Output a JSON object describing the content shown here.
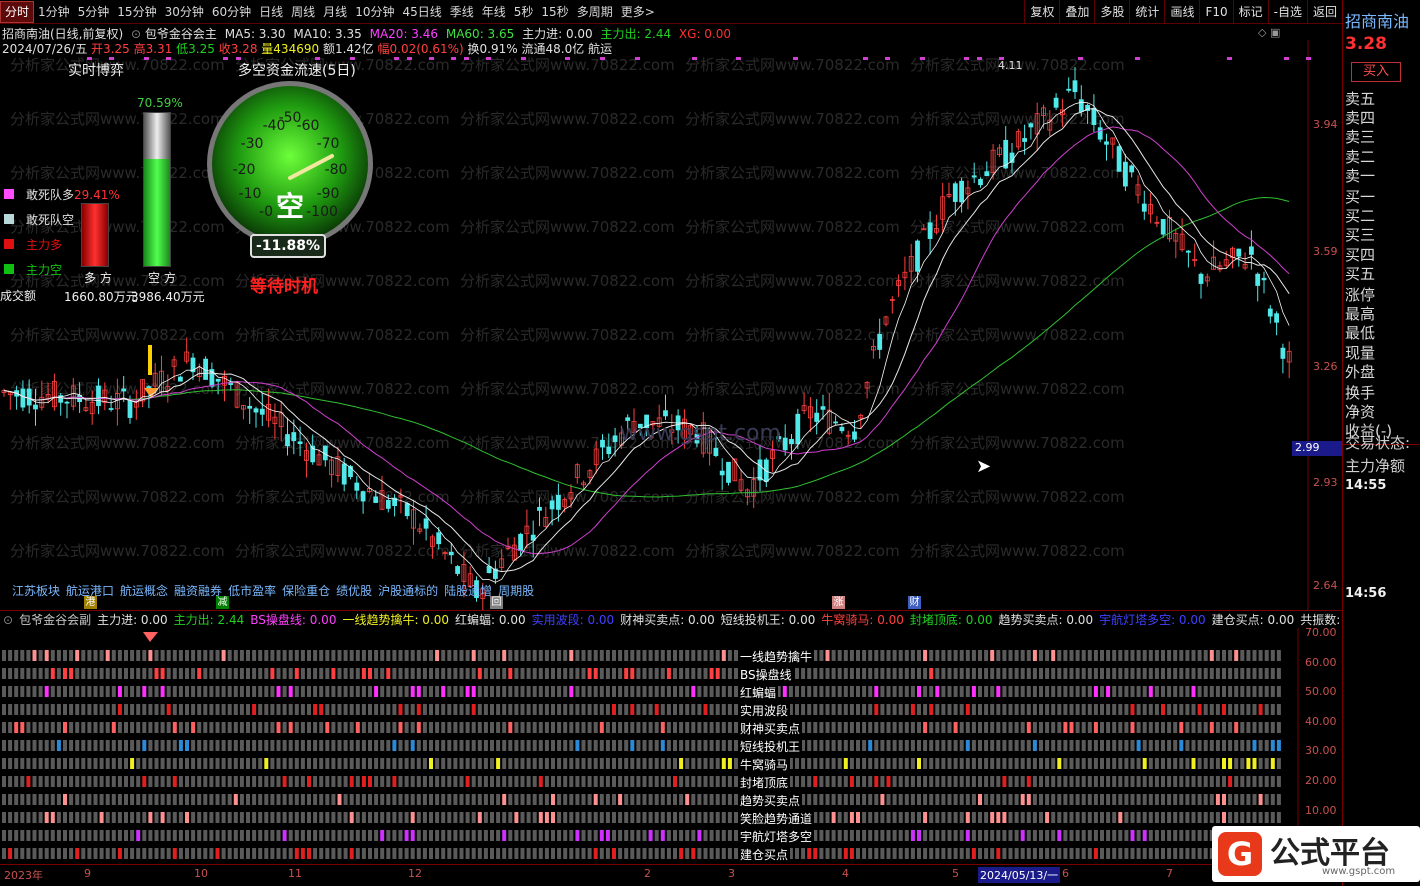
{
  "toolbar": {
    "periods": [
      "分时",
      "1分钟",
      "5分钟",
      "15分钟",
      "30分钟",
      "60分钟",
      "日线",
      "周线",
      "月线",
      "10分钟",
      "45日线",
      "季线",
      "年线",
      "5秒",
      "15秒",
      "多周期",
      "更多>"
    ],
    "active_period": "分时",
    "tools": [
      "复权",
      "叠加",
      "多股",
      "统计",
      "画线",
      "F10",
      "标记",
      "-自选",
      "返回"
    ]
  },
  "stock": {
    "title": "招商南油(日线,前复权)",
    "indicator_name": "包爷金谷会主",
    "ma5": "MA5: 3.30",
    "ma10": "MA10: 3.35",
    "ma20": "MA20: 3.46",
    "ma60": "MA60: 3.65",
    "zljin": "主力进: 0.00",
    "zlchu": "主力出: 2.44",
    "xg": "XG: 0.00",
    "date": "2024/07/26/五",
    "open": "开3.25",
    "high": "高3.31",
    "low": "低3.25",
    "close": "收3.28",
    "volume": "量434690",
    "amount": "额1.42亿",
    "change": "幅0.02(0.61%)",
    "turnover": "换0.91%",
    "float": "流通48.0亿",
    "sector": "航运"
  },
  "widget": {
    "realtime_title": "实时博弈",
    "flow_title": "多空资金流速(5日)",
    "legend": [
      {
        "label": "敢死队多",
        "color": "#ff4cff",
        "value": "29.41%"
      },
      {
        "label": "敢死队空",
        "color": "#b8d8d8",
        "value": ""
      },
      {
        "label": "主力多",
        "color": "#e01010",
        "value": ""
      },
      {
        "label": "主力空",
        "color": "#10c010",
        "value": ""
      }
    ],
    "bar_pct": "70.59%",
    "duo_label": "多 方",
    "kong_label": "空 方",
    "cje_label": "成交额",
    "duo_amount": "1660.80万元",
    "kong_amount": "3986.40万元",
    "gauge_text": "空",
    "gauge_value": "-11.88%",
    "gauge_ticks": [
      "-40",
      "-50",
      "-60",
      "-30",
      "-70",
      "-20",
      "-80",
      "-10",
      "-90",
      "-0",
      "-100"
    ],
    "signal": "等待时机",
    "bar_level": 0.7059
  },
  "chart_data": {
    "type": "candlestick",
    "y_labels": [
      "3.94",
      "3.59",
      "3.26",
      "2.93",
      "2.64"
    ],
    "current_price_tag": "2.99",
    "high_mark": "4.11",
    "watermark": "www.gspt.com",
    "watermark_rows": "分析家公式网www.70822.com",
    "ylim": [
      2.55,
      4.2
    ]
  },
  "tags": [
    "江苏板块",
    "航运港口",
    "航运概念",
    "融资融券",
    "低市盈率",
    "保险重仓",
    "绩优股",
    "沪股通标的",
    "陆股通增",
    "周期股"
  ],
  "event_marks": [
    "港",
    "减",
    "回",
    "涨",
    "财"
  ],
  "lower": {
    "header": [
      {
        "text": "包爷金谷会副",
        "color": "#c8c8c8"
      },
      {
        "text": "主力进: 0.00",
        "color": "#e0e0e0"
      },
      {
        "text": "主力出: 2.44",
        "color": "#20d020"
      },
      {
        "text": "BS操盘线: 0.00",
        "color": "#ff40ff"
      },
      {
        "text": "一线趋势擒牛: 0.00",
        "color": "#f0f020"
      },
      {
        "text": "红蝙蝠: 0.00",
        "color": "#e0e0e0"
      },
      {
        "text": "实用波段: 0.00",
        "color": "#4040ff"
      },
      {
        "text": "财神买卖点: 0.00",
        "color": "#e0e0e0"
      },
      {
        "text": "短线投机王: 0.00",
        "color": "#e0e0e0"
      },
      {
        "text": "牛窝骑马: 0.00",
        "color": "#ff4040"
      },
      {
        "text": "封堵顶底: 0.00",
        "color": "#20d020"
      },
      {
        "text": "趋势买卖点: 0.00",
        "color": "#e0e0e0"
      },
      {
        "text": "宇航灯塔多空: 0.00",
        "color": "#4040ff"
      },
      {
        "text": "建仓买点: 0.00",
        "color": "#e0e0e0"
      },
      {
        "text": "共振数: 0.00",
        "color": "#e0e0e0"
      }
    ],
    "y_labels": [
      "70.00",
      "60.00",
      "50.00",
      "40.00",
      "30.00",
      "20.00",
      "10.00"
    ],
    "series": [
      "一线趋势擒牛",
      "BS操盘线",
      "红蝙蝠",
      "实用波段",
      "财神买卖点",
      "短线投机王",
      "牛窝骑马",
      "封堵顶底",
      "趋势买卖点",
      "笑脸趋势通道",
      "宇航灯塔多空",
      "建仓买点"
    ],
    "row_colors": [
      "#ff9090",
      "#ff4040",
      "#ff30ff",
      "#e02020",
      "#ff6060",
      "#2a8ad8",
      "#f0f020",
      "#e02020",
      "#ff9090",
      "#ff9090",
      "#d030ff",
      "#e02020"
    ]
  },
  "dates": [
    "2023年",
    "9",
    "10",
    "11",
    "12",
    "2",
    "3",
    "4",
    "5",
    "2024/05/13/一",
    "6",
    "7"
  ],
  "right_panel": {
    "name": "招商南油",
    "price": "3.28",
    "buy_btn": "买入",
    "sells": [
      "卖五",
      "卖四",
      "卖三",
      "卖二",
      "卖一"
    ],
    "buys": [
      "买一",
      "买二",
      "买三",
      "买四",
      "买五"
    ],
    "stats": [
      "涨停",
      "最高",
      "最低",
      "现量",
      "外盘",
      "换手",
      "净资",
      "收益(-)"
    ],
    "trade_status": "交易状态:",
    "zljm": "主力净额",
    "time1": "14:55",
    "time2": "14:56"
  },
  "logo": {
    "text": "公式平台",
    "url": "www.gspt.com"
  }
}
